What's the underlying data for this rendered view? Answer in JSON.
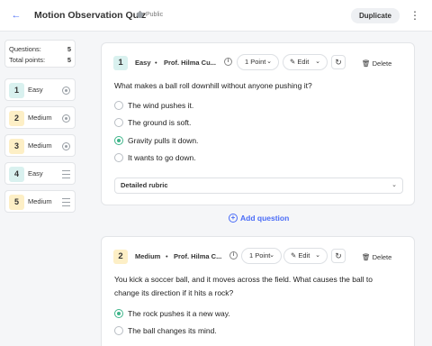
{
  "header": {
    "back_icon": "arrow-left-icon",
    "title": "Motion Observation Quiz",
    "visibility": "Public",
    "duplicate_label": "Duplicate",
    "more_icon": "kebab-icon"
  },
  "sidebar": {
    "questions_label": "Questions:",
    "questions_value": "5",
    "points_label": "Total points:",
    "points_value": "5",
    "items": [
      {
        "num": "1",
        "label": "Easy",
        "icon": "radio-icon"
      },
      {
        "num": "2",
        "label": "Medium",
        "icon": "radio-icon"
      },
      {
        "num": "3",
        "label": "Medium",
        "icon": "radio-icon"
      },
      {
        "num": "4",
        "label": "Easy",
        "icon": "lines-icon"
      },
      {
        "num": "5",
        "label": "Medium",
        "icon": "lines-icon"
      }
    ]
  },
  "questions": [
    {
      "num": "1",
      "difficulty": "Easy",
      "author": "Prof. Hilma Cu...",
      "points": "1 Point",
      "edit_label": "Edit",
      "delete_label": "Delete",
      "text": "What makes a ball roll downhill without anyone pushing it?",
      "options": [
        "The wind pushes it.",
        "The ground is soft.",
        "Gravity pulls it down.",
        "It wants to go down."
      ],
      "selected": 2,
      "rubric_label": "Detailed rubric"
    },
    {
      "num": "2",
      "difficulty": "Medium",
      "author": "Prof. Hilma C...",
      "points": "1 Point",
      "edit_label": "Edit",
      "delete_label": "Delete",
      "text_line1": "You kick a soccer ball, and it moves across the field. What causes the ball to",
      "text_line2": "change its direction if it hits a rock?",
      "options": [
        "The rock pushes it a new way.",
        "The ball changes its mind."
      ],
      "selected": 0
    }
  ],
  "add_question_label": "Add question",
  "colors": {
    "accent": "#4a6cf7",
    "easy": "#d9f1ef",
    "medium": "#fdefc6",
    "correct": "#3fb58a"
  }
}
